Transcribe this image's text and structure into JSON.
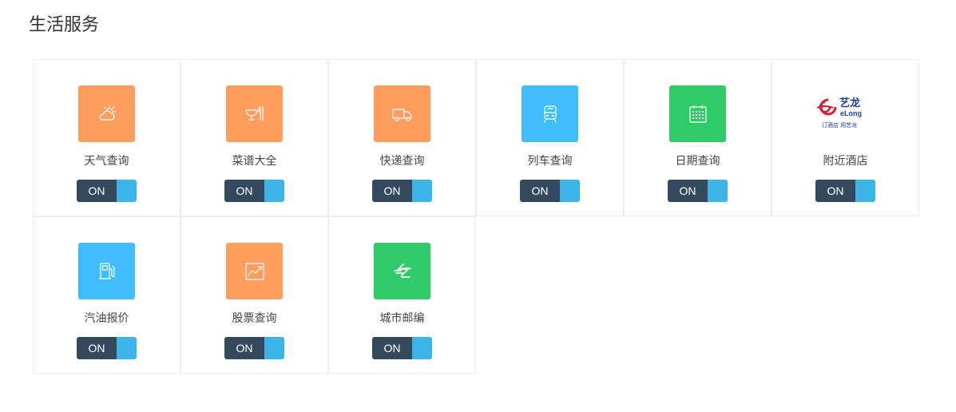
{
  "page": {
    "title": "生活服务"
  },
  "services": [
    {
      "label": "天气查询",
      "toggle": "ON",
      "icon": "weather-icon",
      "color": "#fe9d5e"
    },
    {
      "label": "菜谱大全",
      "toggle": "ON",
      "icon": "recipe-icon",
      "color": "#fe9d5e"
    },
    {
      "label": "快递查询",
      "toggle": "ON",
      "icon": "delivery-truck-icon",
      "color": "#fe9d5e"
    },
    {
      "label": "列车查询",
      "toggle": "ON",
      "icon": "train-icon",
      "color": "#3fbdfd"
    },
    {
      "label": "日期查询",
      "toggle": "ON",
      "icon": "calendar-icon",
      "color": "#2ecb68"
    },
    {
      "label": "附近酒店",
      "toggle": "ON",
      "icon": "elong-logo",
      "logo_text": "艺龙",
      "logo_sub": "eLong",
      "logo_slogan": "订酒店 用艺龙"
    },
    {
      "label": "汽油报价",
      "toggle": "ON",
      "icon": "gas-pump-icon",
      "color": "#3fbdfd"
    },
    {
      "label": "股票查询",
      "toggle": "ON",
      "icon": "stock-chart-icon",
      "color": "#fe9d5e"
    },
    {
      "label": "城市邮编",
      "toggle": "ON",
      "icon": "postal-icon",
      "color": "#2ecb68"
    }
  ],
  "colors": {
    "toggle_on": "#34495e",
    "toggle_knob": "#3cb4e7"
  }
}
